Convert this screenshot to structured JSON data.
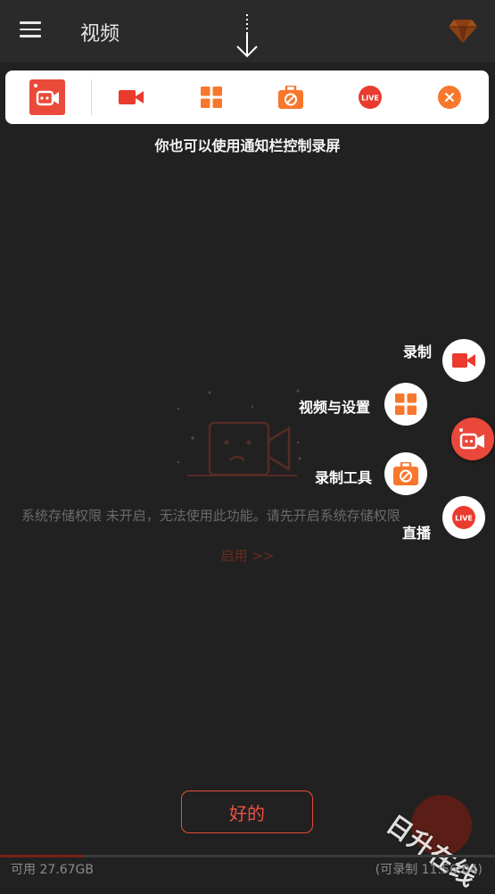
{
  "header": {
    "title": "视频"
  },
  "notification_hint": "你也可以使用通知栏控制录屏",
  "empty_state": {
    "message": "系统存储权限 未开启，无法使用此功能。请先开启系统存储权限",
    "enable_link": "启用 >>"
  },
  "fab_menu": {
    "items": [
      {
        "label": "录制",
        "icon": "video-camera-icon"
      },
      {
        "label": "视频与设置",
        "icon": "grid-icon"
      },
      {
        "label": "录制工具",
        "icon": "toolbox-icon"
      },
      {
        "label": "直播",
        "icon": "live-icon"
      }
    ]
  },
  "ok_button": "好的",
  "watermark": "日升在线",
  "footer": {
    "available": "可用 27.67GB",
    "remaining": "(可录制 11:56:04)",
    "storage_used_fraction": 0.17
  },
  "colors": {
    "accent": "#e9483a",
    "orange": "#f7772c",
    "panel_bg": "#ffffff",
    "background": "#212121"
  }
}
